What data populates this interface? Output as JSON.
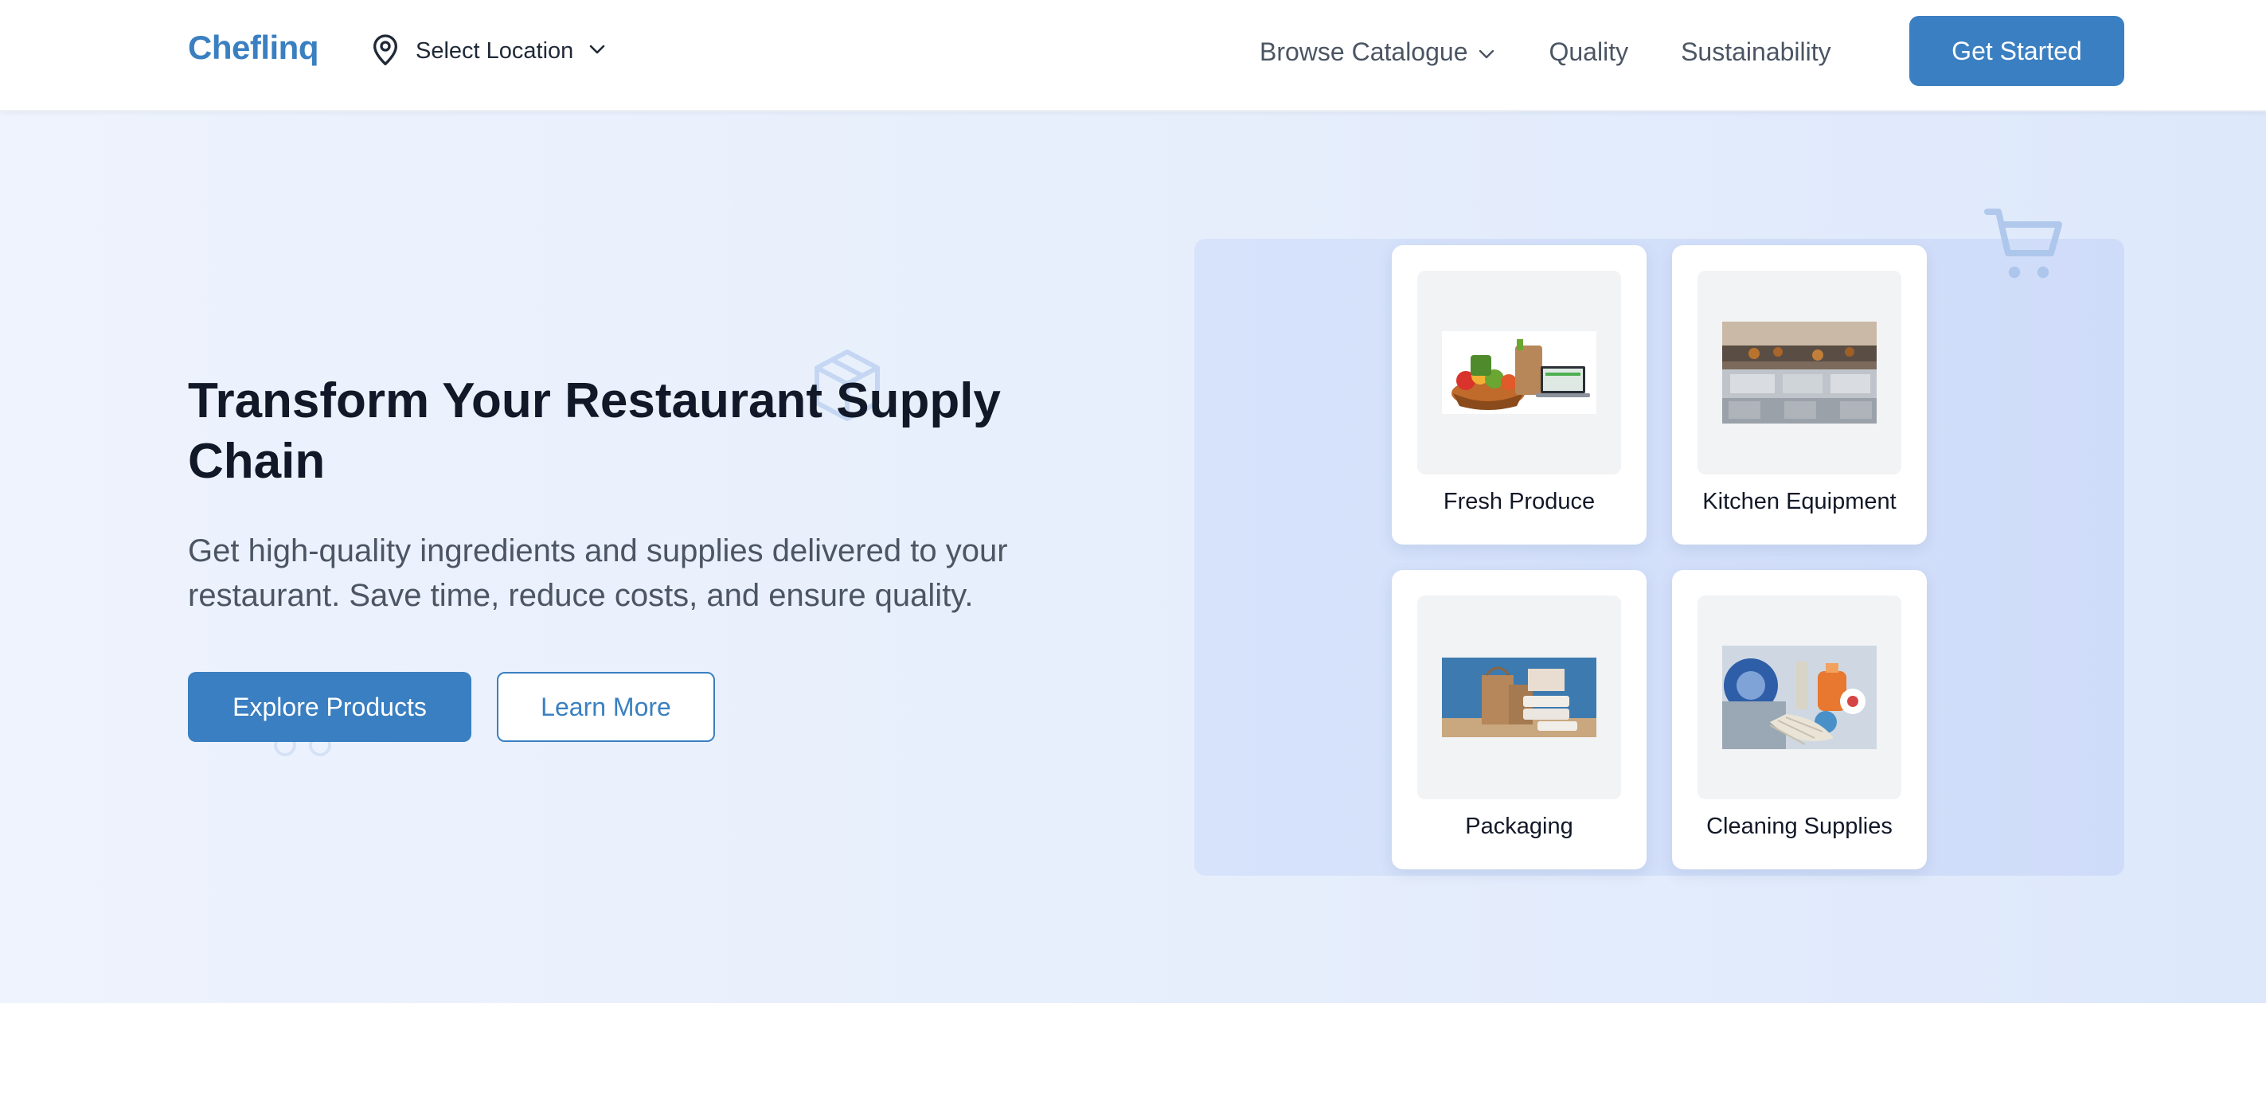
{
  "header": {
    "brand": "Cheflinq",
    "location_label": "Select Location",
    "nav": [
      {
        "label": "Browse Catalogue",
        "has_dropdown": true
      },
      {
        "label": "Quality"
      },
      {
        "label": "Sustainability"
      }
    ],
    "cta_label": "Get Started"
  },
  "hero": {
    "title": "Transform Your Restaurant Supply Chain",
    "subtitle": "Get high-quality ingredients and supplies delivered to your restaurant. Save time, reduce costs, and ensure quality.",
    "primary_button": "Explore Products",
    "secondary_button": "Learn More"
  },
  "categories": [
    {
      "label": "Fresh Produce",
      "image": "grocery-bag-laptop-image"
    },
    {
      "label": "Kitchen Equipment",
      "image": "commercial-kitchen-image"
    },
    {
      "label": "Packaging",
      "image": "takeout-packaging-image"
    },
    {
      "label": "Cleaning Supplies",
      "image": "cleaning-supplies-image"
    }
  ],
  "icons": {
    "location": "map-pin-icon",
    "dropdown": "chevron-down-icon",
    "decor": [
      "box-icon",
      "cart-icon"
    ]
  },
  "colors": {
    "brand": "#3a7fc1",
    "heading": "#111827",
    "body_text": "#4b5563",
    "hero_bg": "#e6eefc",
    "panel_bg": "#d4e0fa"
  }
}
